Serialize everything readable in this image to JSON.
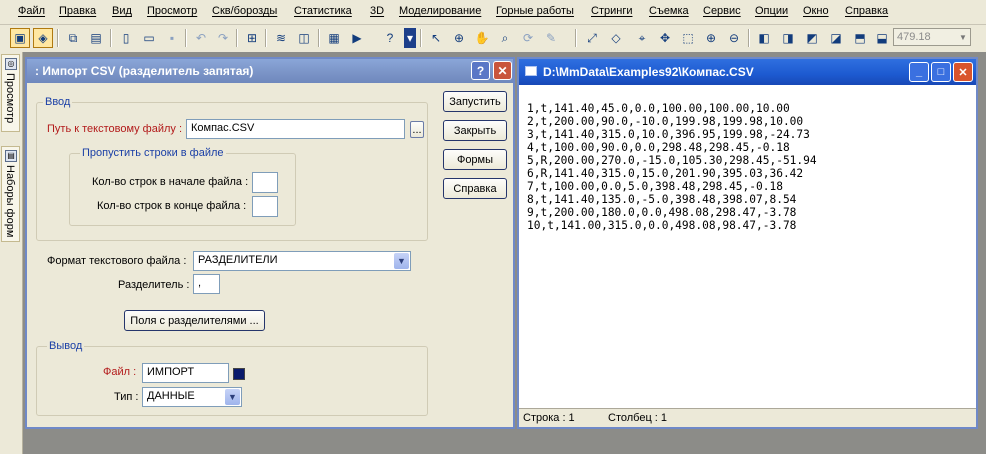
{
  "menu": [
    "Файл",
    "Правка",
    "Вид",
    "Просмотр",
    "Скв/борозды",
    "Статистика",
    "3D",
    "Моделирование",
    "Горные работы",
    "Стринги",
    "Съемка",
    "Сервис",
    "Опции",
    "Окно",
    "Справка"
  ],
  "toolbar": {
    "zoom_value": "479.18"
  },
  "side_tabs": {
    "view": "Просмотр",
    "forms": "Наборы форм"
  },
  "dialog": {
    "title": ": Импорт CSV (разделитель запятая)",
    "help_glyph": "?",
    "close_glyph": "✕",
    "input_group": "Ввод",
    "path_label": "Путь к текстовому файлу :",
    "path_value": "Компас.CSV",
    "browse_label": "...",
    "skip_group": "Пропустить строки в файле",
    "skip_start_label": "Кол-во строк в начале файла :",
    "skip_start_value": "",
    "skip_end_label": "Кол-во строк в конце файла :",
    "skip_end_value": "",
    "format_label": "Формат текстового файла :",
    "format_value": "РАЗДЕЛИТЕЛИ",
    "delimiter_label": "Разделитель :",
    "delimiter_value": ",",
    "fields_button": "Поля с разделителями ...",
    "output_group": "Вывод",
    "file_label": "Файл :",
    "file_value": "ИМПОРТ",
    "type_label": "Тип :",
    "type_value": "ДАННЫЕ",
    "buttons": {
      "run": "Запустить",
      "close": "Закрыть",
      "forms": "Формы",
      "help": "Справка"
    },
    "swatch_color": "#0a1a6b"
  },
  "viewer": {
    "title": "D:\\MmData\\Examples92\\Компас.CSV",
    "lines": [
      "1,t,141.40,45.0,0.0,100.00,100.00,10.00",
      "2,t,200.00,90.0,-10.0,199.98,199.98,10.00",
      "3,t,141.40,315.0,10.0,396.95,199.98,-24.73",
      "4,t,100.00,90.0,0.0,298.48,298.45,-0.18",
      "5,R,200.00,270.0,-15.0,105.30,298.45,-51.94",
      "6,R,141.40,315.0,15.0,201.90,395.03,36.42",
      "7,t,100.00,0.0,5.0,398.48,298.45,-0.18",
      "8,t,141.40,135.0,-5.0,398.48,398.07,8.54",
      "9,t,200.00,180.0,0.0,498.08,298.47,-3.78",
      "10,t,141.00,315.0,0.0,498.08,98.47,-3.78"
    ],
    "status_row": "Строка : 1",
    "status_col": "Столбец : 1"
  }
}
